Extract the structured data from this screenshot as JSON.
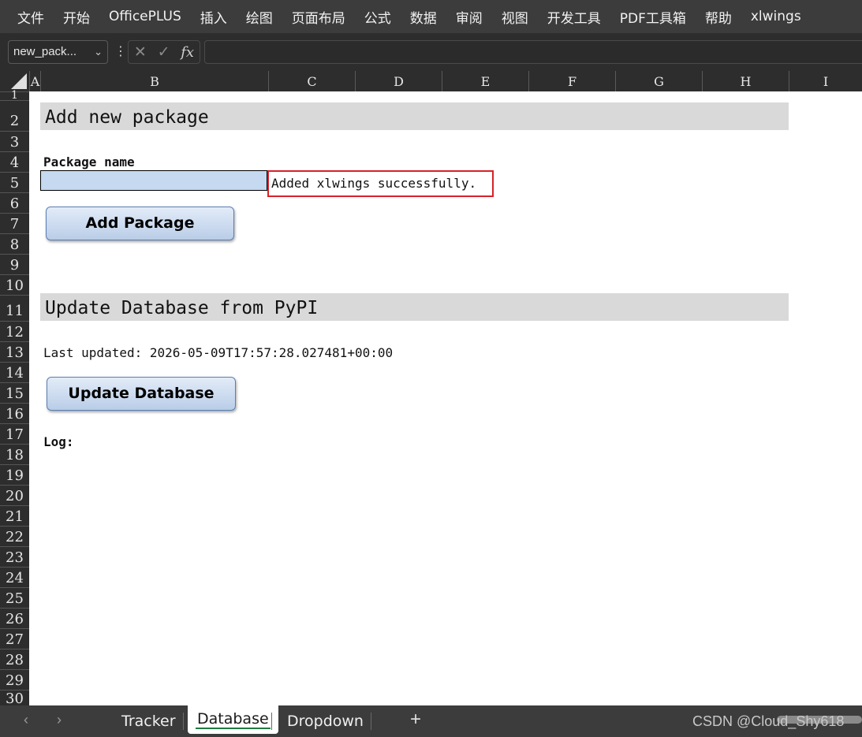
{
  "menu": [
    "文件",
    "开始",
    "OfficePLUS",
    "插入",
    "绘图",
    "页面布局",
    "公式",
    "数据",
    "审阅",
    "视图",
    "开发工具",
    "PDF工具箱",
    "帮助",
    "xlwings"
  ],
  "formula_bar": {
    "name_box": "new_pack...",
    "fx_label": "fx",
    "formula": ""
  },
  "columns": [
    "A",
    "B",
    "C",
    "D",
    "E",
    "F",
    "G",
    "H",
    "I"
  ],
  "rows": [
    "1",
    "2",
    "3",
    "4",
    "5",
    "6",
    "7",
    "8",
    "9",
    "10",
    "11",
    "12",
    "13",
    "14",
    "15",
    "16",
    "17",
    "18",
    "19",
    "20",
    "21",
    "22",
    "23",
    "24",
    "25",
    "26",
    "27",
    "28",
    "29",
    "30"
  ],
  "content": {
    "add_heading": "Add new package",
    "package_name_label": "Package name",
    "package_name_value": "",
    "status_message": "Added xlwings successfully.",
    "add_button": "Add Package",
    "update_heading": "Update Database from PyPI",
    "last_updated": "Last updated: 2026-05-09T17:57:28.027481+00:00",
    "update_button": "Update Database",
    "log_label": "Log:"
  },
  "tabs": {
    "items": [
      "Tracker",
      "Database",
      "Dropdown"
    ],
    "active": "Database",
    "nav_prev": "‹",
    "nav_next": "›",
    "add": "+"
  },
  "watermark": "CSDN @Cloud_Shy618",
  "colors": {
    "ribbon_bg": "#3c3c3c",
    "heading_bg": "#d9d9d9",
    "input_fill": "#c5d9f1",
    "status_border": "#d6222a",
    "button_border": "#5b7fb5",
    "active_tab_underline": "#1f7a3f"
  }
}
